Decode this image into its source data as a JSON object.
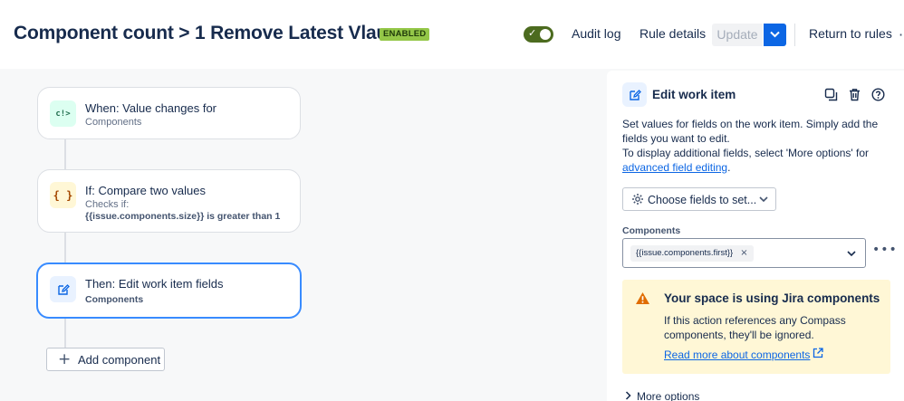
{
  "header": {
    "title": "Component count > 1 Remove Latest Vlaue",
    "status_badge": "ENABLED",
    "toggle_state": "on",
    "audit_log": "Audit log",
    "rule_details": "Rule details",
    "update": "Update",
    "return_to_rules": "Return to rules"
  },
  "flow": {
    "trigger": {
      "title": "When: Value changes for",
      "subtitle": "Components",
      "icon": "trigger-icon"
    },
    "condition": {
      "title": "If: Compare two values",
      "subtitle": "Checks if:",
      "detail": "{{issue.components.size}} is greater than 1",
      "icon": "braces-icon"
    },
    "action": {
      "title": "Then: Edit work item fields",
      "detail": "Components",
      "icon": "edit-icon"
    },
    "add_component": "Add component"
  },
  "panel": {
    "title": "Edit work item",
    "description_1": "Set values for fields on the work item. Simply add the fields you want to edit.",
    "description_2": "To display additional fields, select 'More options' for",
    "link": "advanced field editing",
    "link_suffix": ".",
    "choose_fields": "Choose fields to set...",
    "field_label": "Components",
    "field_value": "{{issue.components.first}}",
    "warning": {
      "title": "Your space is using Jira components",
      "body": "If this action references any Compass components, they'll be ignored.",
      "link": "Read more about components"
    },
    "more_options": "More options"
  },
  "colors": {
    "accent": "#0c66e4",
    "badge": "#94c748",
    "toggle": "#4c6b1f",
    "warning_bg": "#fff7d6",
    "selected_border": "#388bff"
  }
}
